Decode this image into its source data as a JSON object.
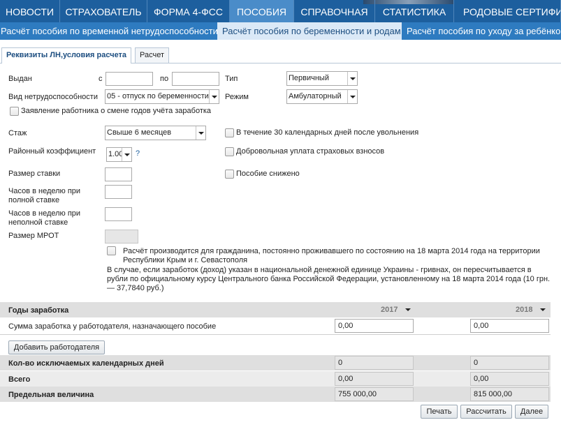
{
  "topnav": {
    "items": [
      {
        "label": "НОВОСТИ"
      },
      {
        "label": "СТРАХОВАТЕЛЬ"
      },
      {
        "label": "ФОРМА 4-ФСС"
      },
      {
        "label": "ПОСОБИЯ",
        "active": true
      },
      {
        "label": "СПРАВОЧНАЯ"
      },
      {
        "label": "СТАТИСТИКА"
      },
      {
        "label": "РОДОВЫЕ СЕРТИФИКАТЫ"
      }
    ]
  },
  "subnav": {
    "items": [
      {
        "label": "Расчёт пособия по временной нетрудоспособности"
      },
      {
        "label": "Расчёт пособия по беременности и родам",
        "active": true
      },
      {
        "label": "Расчёт пособия по уходу за ребёнком"
      }
    ]
  },
  "tabs": [
    {
      "label": "Реквизиты ЛН,условия расчета",
      "active": true
    },
    {
      "label": "Расчет"
    }
  ],
  "form": {
    "issued_label": "Выдан",
    "from_label": "с",
    "to_label": "по",
    "from_value": "",
    "to_value": "",
    "type_label": "Тип",
    "type_value": "Первичный",
    "disability_label": "Вид нетрудоспособности",
    "disability_value": "05 - отпуск по беременности",
    "mode_label": "Режим",
    "mode_value": "Амбулаторный",
    "change_years_label": "Заявление работника о смене годов учёта заработка",
    "experience_label": "Стаж",
    "experience_value": "Свыше 6 месяцев",
    "within30_label": "В течение 30 календарных дней после увольнения",
    "district_label": "Районный коэффициент",
    "district_value": "1.00",
    "district_help": "?",
    "voluntary_label": "Добровольная уплата страховых взносов",
    "rate_label": "Размер ставки",
    "reduced_label": "Пособие снижено",
    "full_hours_label": "Часов в неделю при полной ставке",
    "part_hours_label": "Часов в неделю при неполной ставке",
    "mrot_label": "Размер МРОТ",
    "crimea_label": "Расчёт производится для гражданина, постоянно проживавшего по состоянию на 18 марта 2014 года на территории Республики Крым и г. Севастополя",
    "crimea_note": "В случае, если заработок (доход) указан в национальной денежной единице Украины - гривнах, он пересчитывается в рубли по официальному курсу Центрального банка Российской Федерации, установленному на 18 марта 2014 года (10 грн. — 37,7840 руб.)"
  },
  "earnings": {
    "years_label": "Годы заработка",
    "year1": "2017",
    "year2": "2018",
    "sum_label": "Сумма заработка у работодателя, назначающего пособие",
    "sum1": "0,00",
    "sum2": "0,00",
    "add_employer_label": "Добавить работодателя",
    "excluded_label": "Кол-во исключаемых календарных дней",
    "excluded1": "0",
    "excluded2": "0",
    "total_label": "Всего",
    "total1": "0,00",
    "total2": "0,00",
    "limit_label": "Предельная величина",
    "limit1": "755 000,00",
    "limit2": "815 000,00"
  },
  "actions": {
    "print_label": "Печать",
    "calculate_label": "Рассчитать",
    "next_label": "Далее"
  }
}
